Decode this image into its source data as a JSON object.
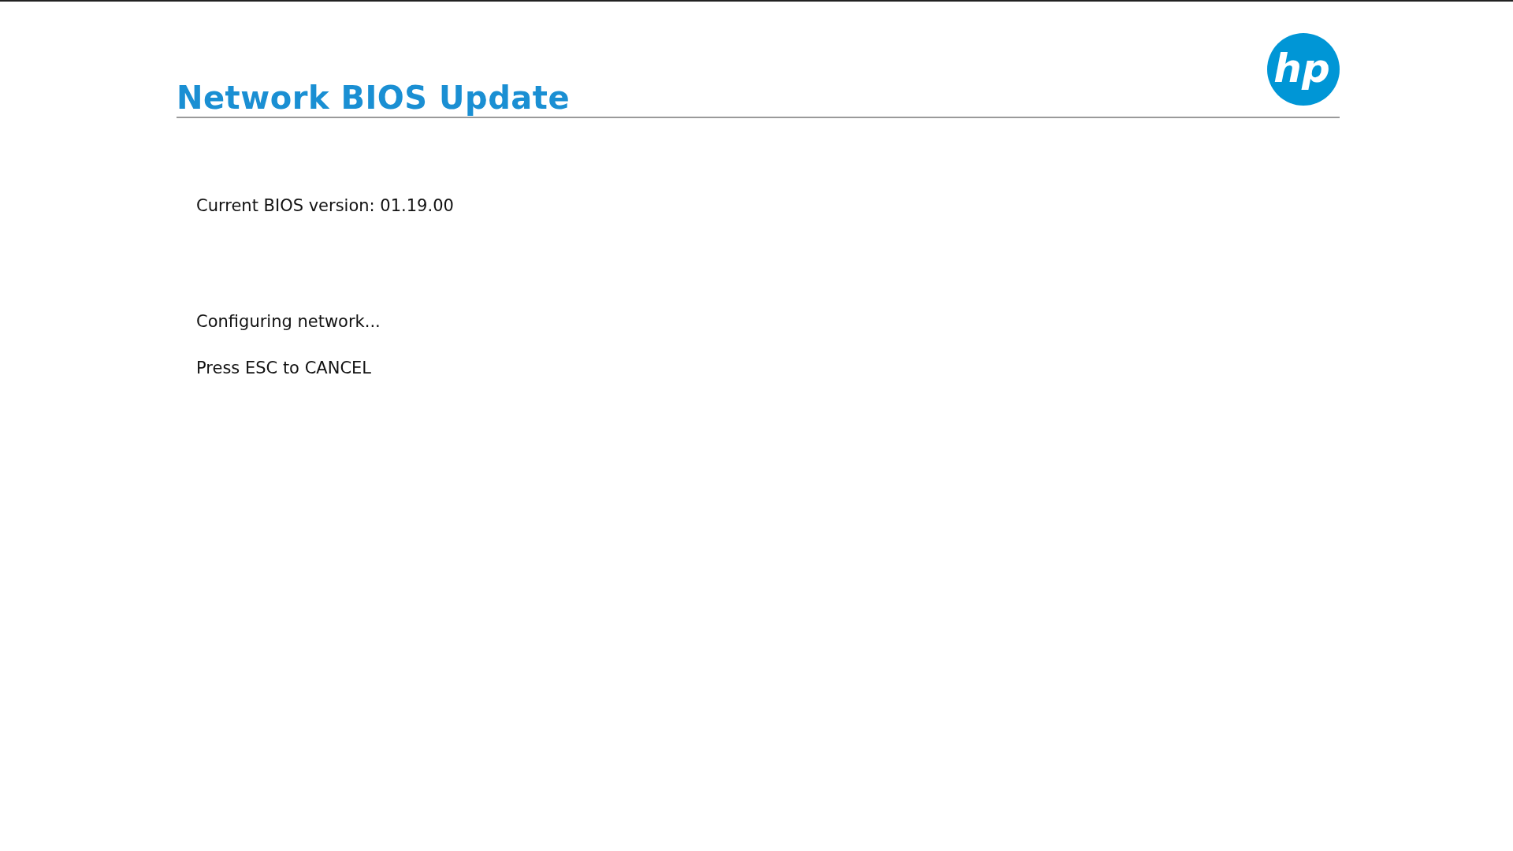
{
  "header": {
    "title": "Network BIOS Update",
    "logo_text": "hp"
  },
  "lines": [
    "Current BIOS version: 01.19.00",
    "Configuring network...",
    "Press ESC to CANCEL"
  ]
}
